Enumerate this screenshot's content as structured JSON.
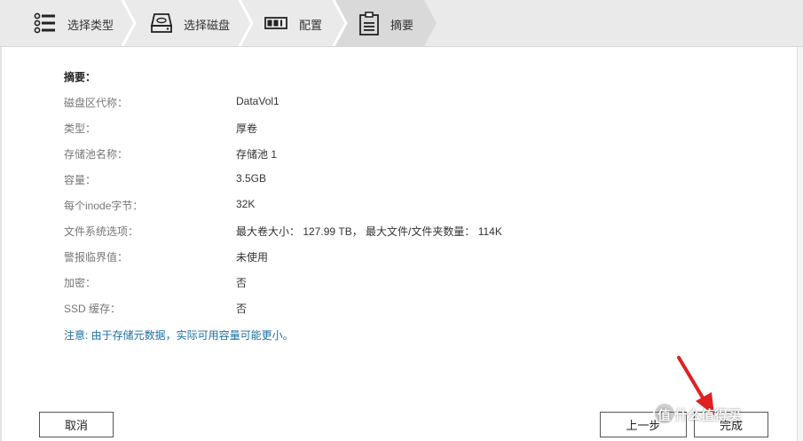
{
  "steps": [
    {
      "label": "选择类型",
      "icon": "list-icon",
      "active": false
    },
    {
      "label": "选择磁盘",
      "icon": "disk-icon",
      "active": false
    },
    {
      "label": "配置",
      "icon": "config-icon",
      "active": false
    },
    {
      "label": "摘要",
      "icon": "clipboard-icon",
      "active": true
    }
  ],
  "summary": {
    "title": "摘要：",
    "rows": [
      {
        "key": "磁盘区代称：",
        "value": "DataVol1"
      },
      {
        "key": "类型：",
        "value": "厚卷"
      },
      {
        "key": "存储池名称：",
        "value": "存储池 1"
      },
      {
        "key": "容量：",
        "value": "3.5GB"
      },
      {
        "key": "每个inode字节：",
        "value": "32K"
      },
      {
        "key": "文件系统选项：",
        "value": "最大卷大小： 127.99 TB， 最大文件/文件夹数量： 114K"
      },
      {
        "key": "警报临界值：",
        "value": "未使用"
      },
      {
        "key": "加密：",
        "value": "否"
      },
      {
        "key": "SSD 缓存：",
        "value": "否"
      }
    ],
    "note": "注意: 由于存储元数据，实际可用容量可能更小。"
  },
  "buttons": {
    "cancel": "取消",
    "back": "上一步",
    "finish": "完成"
  },
  "watermark": "值 什么值得买",
  "colors": {
    "step_bar": "#eaeaea",
    "note_text": "#1a6fa3",
    "arrow": "#e02020"
  }
}
